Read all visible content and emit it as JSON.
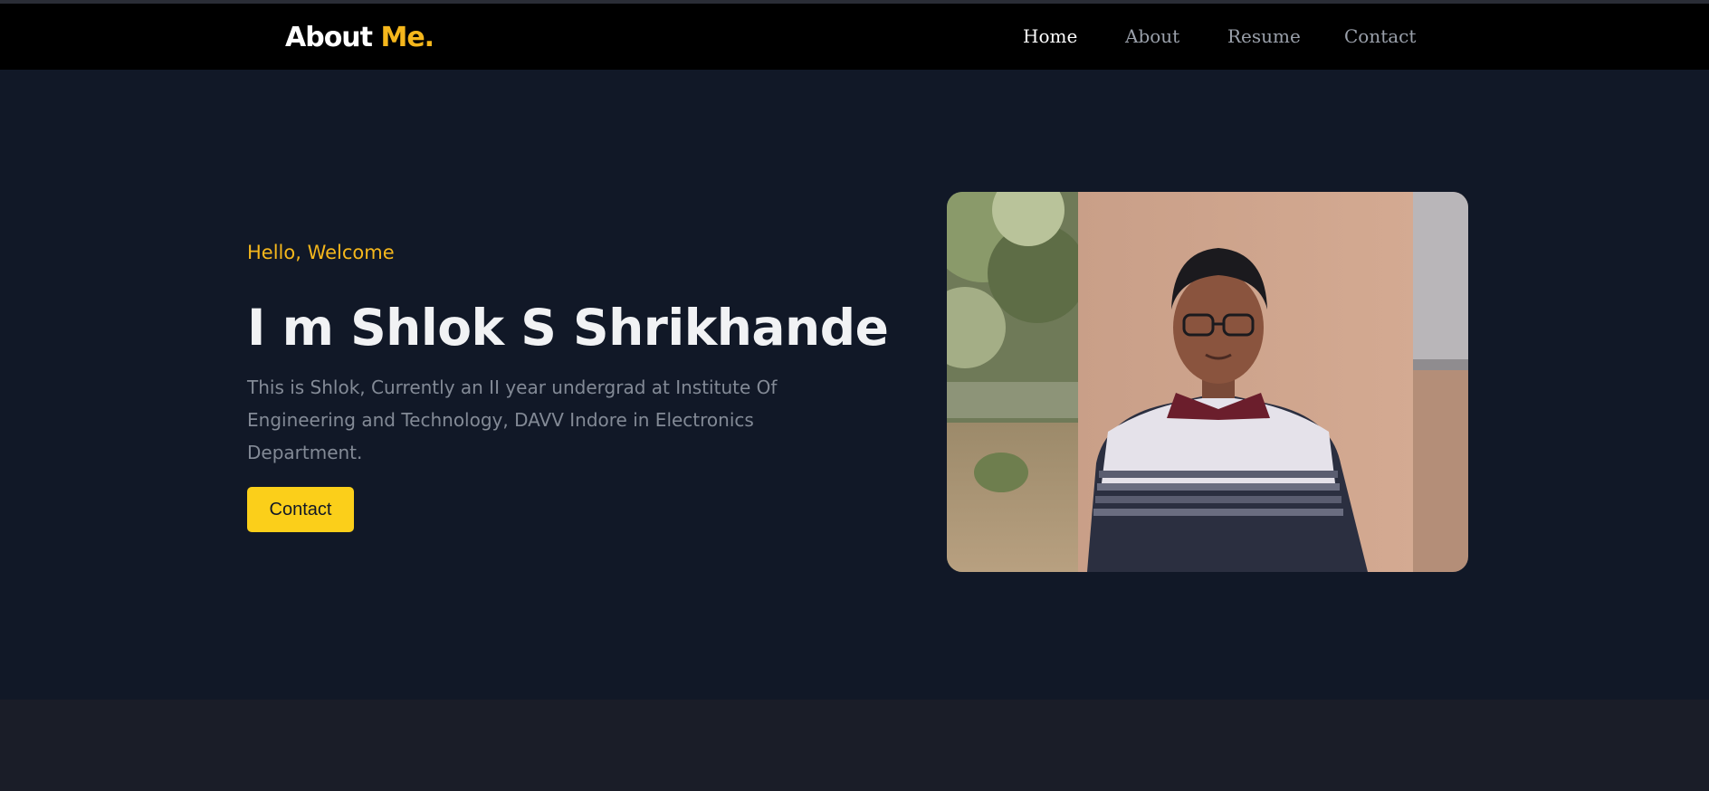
{
  "header": {
    "logo_main": "About",
    "logo_accent": "Me.",
    "nav": [
      {
        "label": "Home",
        "active": true
      },
      {
        "label": "About",
        "active": false
      },
      {
        "label": "Resume",
        "active": false
      },
      {
        "label": "Contact",
        "active": false
      }
    ]
  },
  "hero": {
    "greeting": "Hello, Welcome",
    "title": "I m Shlok S Shrikhande",
    "description": "This is Shlok, Currently an II year undergrad at Institute Of Engineering and Technology, DAVV Indore in Electronics Department.",
    "cta_label": "Contact"
  },
  "colors": {
    "accent": "#f5b71c",
    "button": "#fbcf1a",
    "hero_bg": "#111827",
    "nav_bg": "#000000"
  }
}
